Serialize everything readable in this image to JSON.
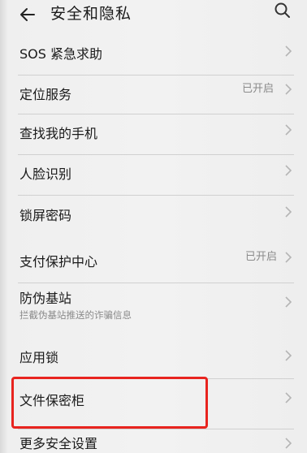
{
  "header": {
    "title": "安全和隐私",
    "back_icon": "back-arrow-icon",
    "search_icon": "search-icon"
  },
  "items": [
    {
      "label": "SOS 紧急求助",
      "value": "",
      "subtitle": ""
    },
    {
      "label": "定位服务",
      "value": "已开启",
      "subtitle": ""
    },
    {
      "label": "查找我的手机",
      "value": "",
      "subtitle": ""
    },
    {
      "label": "人脸识别",
      "value": "",
      "subtitle": ""
    },
    {
      "label": "锁屏密码",
      "value": "",
      "subtitle": ""
    },
    {
      "label": "支付保护中心",
      "value": "已开启",
      "subtitle": ""
    },
    {
      "label": "防伪基站",
      "value": "",
      "subtitle": "拦截伪基站推送的诈骗信息"
    },
    {
      "label": "应用锁",
      "value": "",
      "subtitle": ""
    },
    {
      "label": "文件保密柜",
      "value": "",
      "subtitle": ""
    },
    {
      "label": "更多安全设置",
      "value": "",
      "subtitle": ""
    }
  ],
  "highlight_color": "#e8241f",
  "chevron_icon": "chevron-right-icon"
}
